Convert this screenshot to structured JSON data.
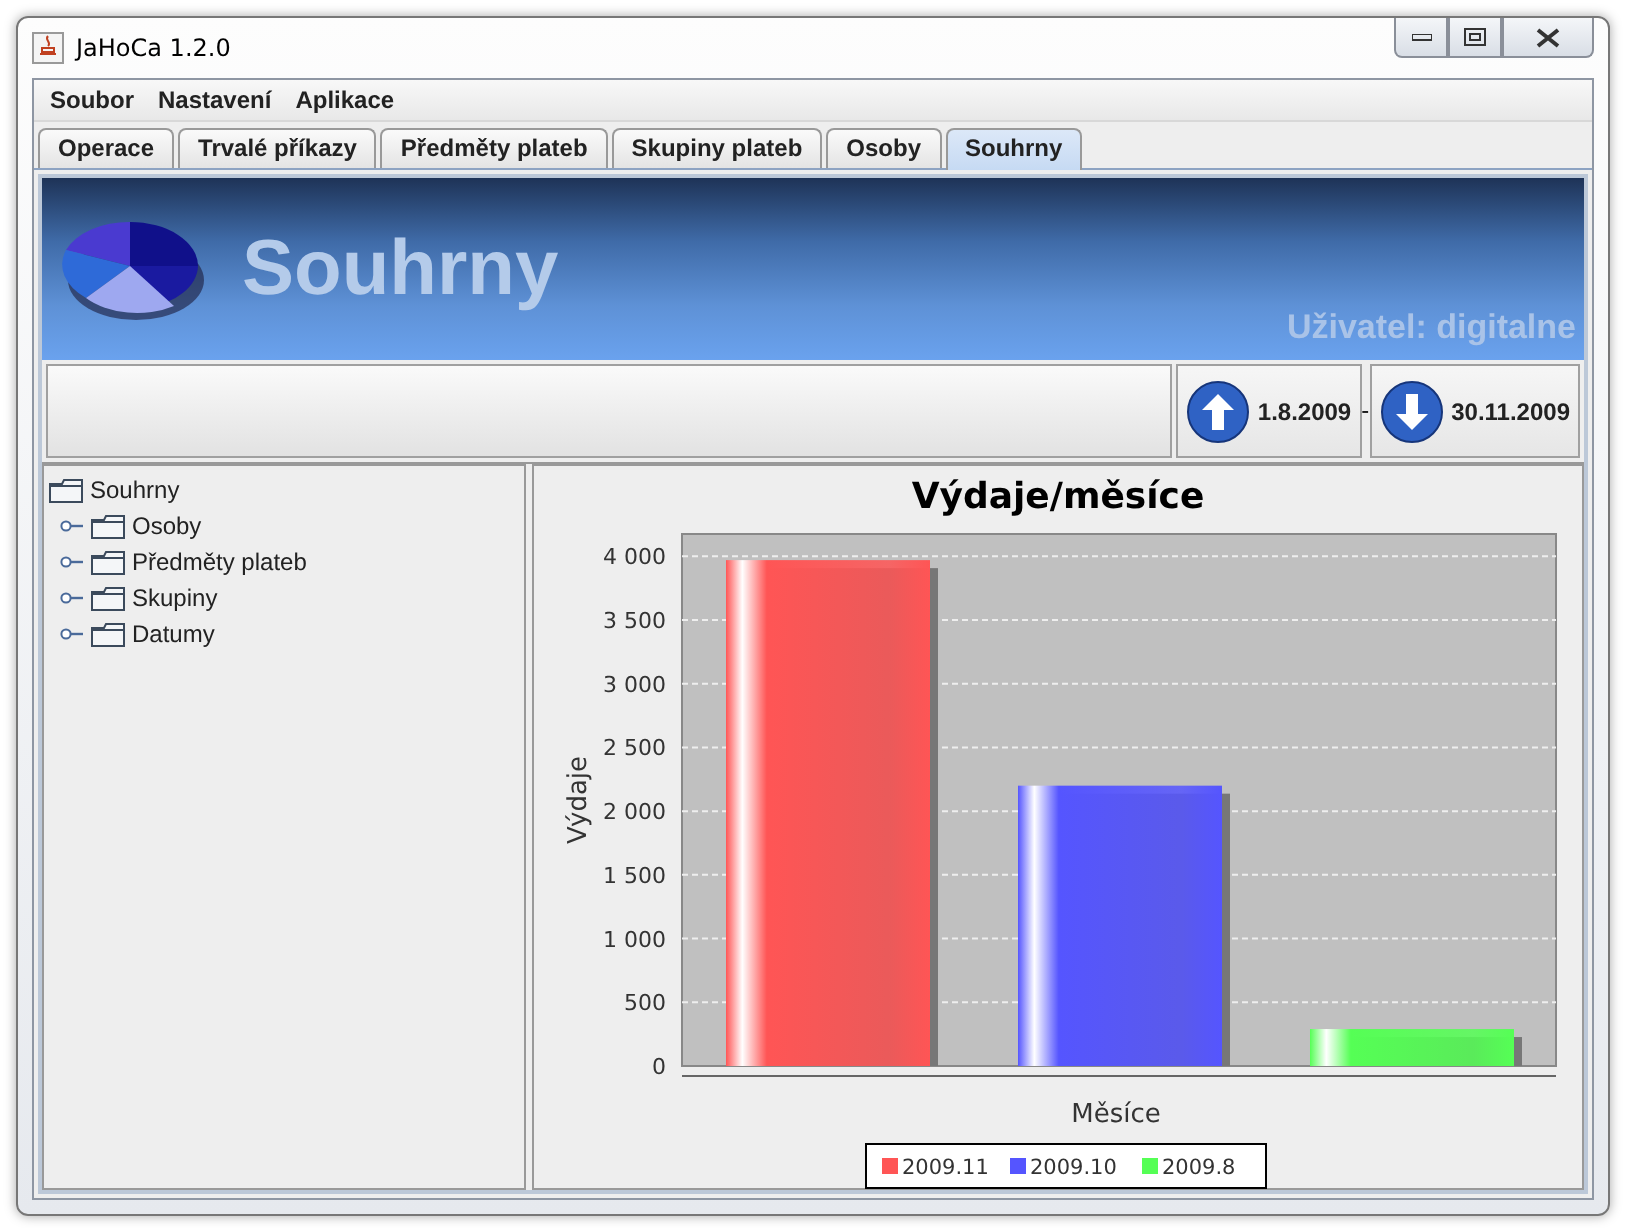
{
  "window": {
    "title": "JaHoCa 1.2.0"
  },
  "menu": [
    "Soubor",
    "Nastavení",
    "Aplikace"
  ],
  "tabs": [
    {
      "label": "Operace",
      "selected": false
    },
    {
      "label": "Trvalé příkazy",
      "selected": false
    },
    {
      "label": "Předměty plateb",
      "selected": false
    },
    {
      "label": "Skupiny plateb",
      "selected": false
    },
    {
      "label": "Osoby",
      "selected": false
    },
    {
      "label": "Souhrny",
      "selected": true
    }
  ],
  "banner": {
    "title": "Souhrny",
    "user": "Uživatel: digitalne"
  },
  "period": {
    "from": "1.8.2009",
    "separator": "-",
    "to": "30.11.2009"
  },
  "tree": {
    "label": "Souhrny",
    "children": [
      {
        "label": "Osoby",
        "expanded": false
      },
      {
        "label": "Předměty plateb",
        "expanded": false
      },
      {
        "label": "Skupiny",
        "expanded": false
      },
      {
        "label": "Datumy",
        "expanded": false
      }
    ]
  },
  "chart_data": {
    "type": "bar",
    "grid": true,
    "legend": true,
    "title": "Výdaje/měsíce",
    "xlabel": "Měsíce",
    "ylabel": "Výdaje",
    "ylim": [
      0,
      4175
    ],
    "yticks": [
      {
        "value": 0,
        "label": "0"
      },
      {
        "value": 500,
        "label": "500"
      },
      {
        "value": 1000,
        "label": "1 000"
      },
      {
        "value": 1500,
        "label": "1 500"
      },
      {
        "value": 2000,
        "label": "2 000"
      },
      {
        "value": 2500,
        "label": "2 500"
      },
      {
        "value": 3000,
        "label": "3 000"
      },
      {
        "value": 3500,
        "label": "3 500"
      },
      {
        "value": 4000,
        "label": "4 000"
      }
    ],
    "series": [
      {
        "name": "2009.11",
        "color": "#ff5555",
        "values": [
          3970
        ]
      },
      {
        "name": "2009.10",
        "color": "#5555ff",
        "values": [
          2200
        ]
      },
      {
        "name": "2009.8",
        "color": "#55ff55",
        "values": [
          290
        ]
      }
    ]
  }
}
